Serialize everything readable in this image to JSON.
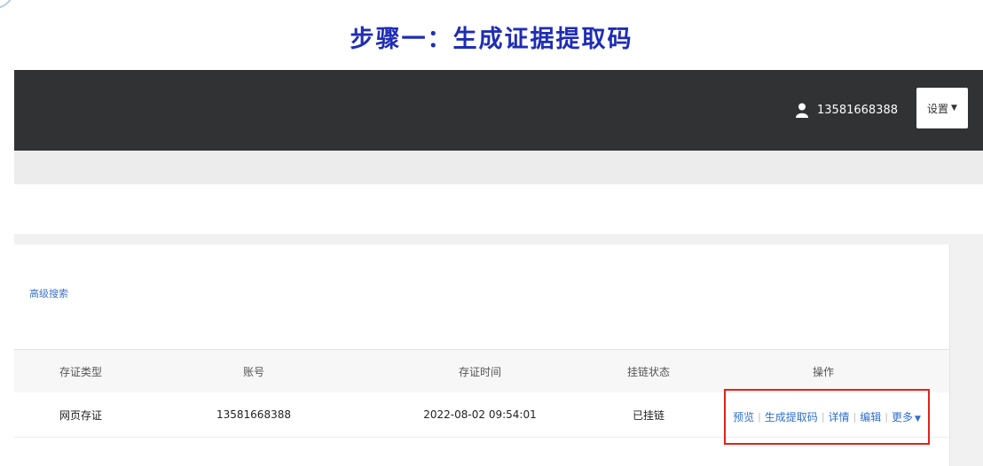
{
  "heading": "步骤一：生成证据提取码",
  "header": {
    "user_phone": "13581668388",
    "settings_label": "设置"
  },
  "filters": {
    "advanced_search": "高级搜索"
  },
  "table": {
    "columns": [
      "存证类型",
      "账号",
      "存证时间",
      "挂链状态",
      "操作"
    ],
    "rows": [
      {
        "type": "网页存证",
        "account": "13581668388",
        "time": "2022-08-02 09:54:01",
        "status": "已挂链"
      }
    ],
    "actions": {
      "preview": "预览",
      "generate_code": "生成提取码",
      "details": "详情",
      "edit": "编辑",
      "more": "更多"
    }
  },
  "colors": {
    "heading": "#1f2db5",
    "topbar": "#303234",
    "link": "#2f6fd0",
    "highlight_box": "#e2231a"
  }
}
